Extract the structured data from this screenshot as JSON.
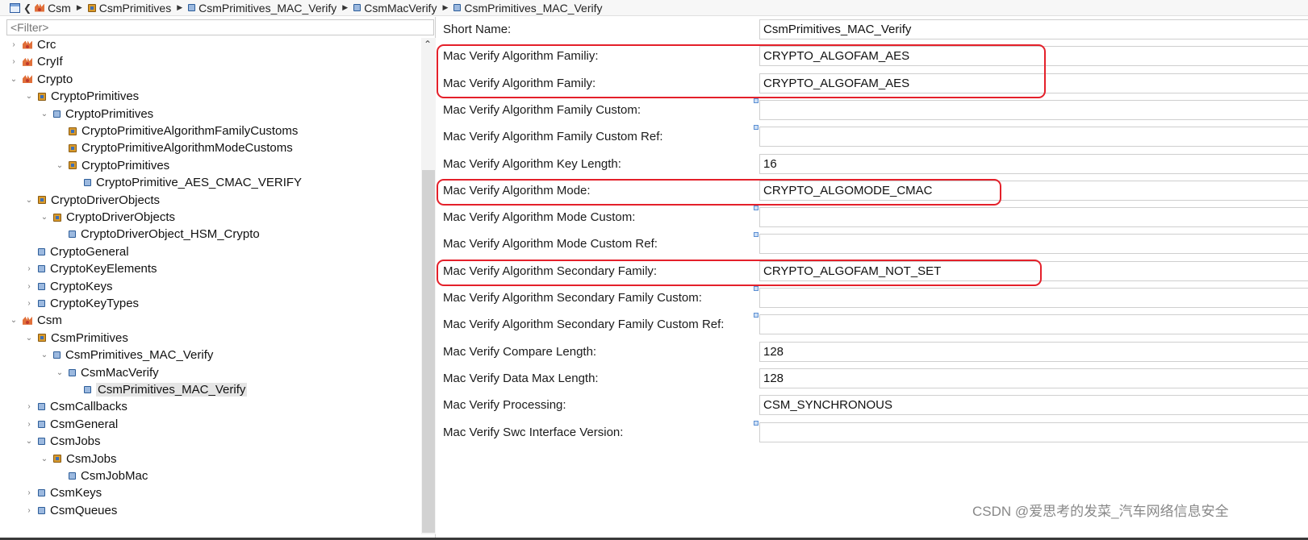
{
  "breadcrumb": [
    {
      "label": "Csm",
      "icon": "module-icon"
    },
    {
      "label": "CsmPrimitives",
      "icon": "package-icon"
    },
    {
      "label": "CsmPrimitives_MAC_Verify",
      "icon": "container-icon"
    },
    {
      "label": "CsmMacVerify",
      "icon": "container-icon"
    },
    {
      "label": "CsmPrimitives_MAC_Verify",
      "icon": "container-icon"
    }
  ],
  "tree": {
    "filter_placeholder": "<Filter>",
    "items": [
      {
        "label": "Crc",
        "level": 0,
        "twisty": "collapsed",
        "icon": "module-icon"
      },
      {
        "label": "CryIf",
        "level": 0,
        "twisty": "collapsed",
        "icon": "module-icon"
      },
      {
        "label": "Crypto",
        "level": 0,
        "twisty": "expanded",
        "icon": "module-icon"
      },
      {
        "label": "CryptoPrimitives",
        "level": 1,
        "twisty": "expanded",
        "icon": "package-icon"
      },
      {
        "label": "CryptoPrimitives",
        "level": 2,
        "twisty": "expanded",
        "icon": "container-icon"
      },
      {
        "label": "CryptoPrimitiveAlgorithmFamilyCustoms",
        "level": 3,
        "twisty": "none",
        "icon": "package-icon"
      },
      {
        "label": "CryptoPrimitiveAlgorithmModeCustoms",
        "level": 3,
        "twisty": "none",
        "icon": "package-icon"
      },
      {
        "label": "CryptoPrimitives",
        "level": 3,
        "twisty": "expanded",
        "icon": "package-icon"
      },
      {
        "label": "CryptoPrimitive_AES_CMAC_VERIFY",
        "level": 4,
        "twisty": "none",
        "icon": "container-icon"
      },
      {
        "label": "CryptoDriverObjects",
        "level": 1,
        "twisty": "expanded",
        "icon": "package-icon"
      },
      {
        "label": "CryptoDriverObjects",
        "level": 2,
        "twisty": "expanded",
        "icon": "package-icon"
      },
      {
        "label": "CryptoDriverObject_HSM_Crypto",
        "level": 3,
        "twisty": "none",
        "icon": "container-icon"
      },
      {
        "label": "CryptoGeneral",
        "level": 1,
        "twisty": "none",
        "icon": "container-icon"
      },
      {
        "label": "CryptoKeyElements",
        "level": 1,
        "twisty": "collapsed",
        "icon": "container-icon"
      },
      {
        "label": "CryptoKeys",
        "level": 1,
        "twisty": "collapsed",
        "icon": "container-icon"
      },
      {
        "label": "CryptoKeyTypes",
        "level": 1,
        "twisty": "collapsed",
        "icon": "container-icon"
      },
      {
        "label": "Csm",
        "level": 0,
        "twisty": "expanded",
        "icon": "module-icon"
      },
      {
        "label": "CsmPrimitives",
        "level": 1,
        "twisty": "expanded",
        "icon": "package-icon"
      },
      {
        "label": "CsmPrimitives_MAC_Verify",
        "level": 2,
        "twisty": "expanded",
        "icon": "container-icon"
      },
      {
        "label": "CsmMacVerify",
        "level": 3,
        "twisty": "expanded",
        "icon": "container-icon"
      },
      {
        "label": "CsmPrimitives_MAC_Verify",
        "level": 4,
        "twisty": "none",
        "icon": "container-icon",
        "selected": true
      },
      {
        "label": "CsmCallbacks",
        "level": 1,
        "twisty": "collapsed",
        "icon": "container-icon"
      },
      {
        "label": "CsmGeneral",
        "level": 1,
        "twisty": "collapsed",
        "icon": "container-icon"
      },
      {
        "label": "CsmJobs",
        "level": 1,
        "twisty": "expanded",
        "icon": "container-icon"
      },
      {
        "label": "CsmJobs",
        "level": 2,
        "twisty": "expanded",
        "icon": "package-icon"
      },
      {
        "label": "CsmJobMac",
        "level": 3,
        "twisty": "none",
        "icon": "container-icon"
      },
      {
        "label": "CsmKeys",
        "level": 1,
        "twisty": "collapsed",
        "icon": "container-icon"
      },
      {
        "label": "CsmQueues",
        "level": 1,
        "twisty": "collapsed",
        "icon": "container-icon"
      }
    ]
  },
  "properties": [
    {
      "label": "Short Name:",
      "value": "CsmPrimitives_MAC_Verify",
      "marker": false,
      "highlight": false
    },
    {
      "label": "Mac Verify Algorithm Familiy:",
      "value": "CRYPTO_ALGOFAM_AES",
      "marker": false,
      "highlight": true
    },
    {
      "label": "Mac Verify Algorithm Family:",
      "value": "CRYPTO_ALGOFAM_AES",
      "marker": false,
      "highlight": true
    },
    {
      "label": "Mac Verify Algorithm Family Custom:",
      "value": "",
      "marker": true,
      "highlight": false
    },
    {
      "label": "Mac Verify Algorithm Family Custom Ref:",
      "value": "",
      "marker": true,
      "highlight": false
    },
    {
      "label": "Mac Verify Algorithm Key Length:",
      "value": "16",
      "marker": false,
      "highlight": false
    },
    {
      "label": "Mac Verify Algorithm Mode:",
      "value": "CRYPTO_ALGOMODE_CMAC",
      "marker": false,
      "highlight": true
    },
    {
      "label": "Mac Verify Algorithm Mode Custom:",
      "value": "",
      "marker": true,
      "highlight": false
    },
    {
      "label": "Mac Verify Algorithm Mode Custom Ref:",
      "value": "",
      "marker": true,
      "highlight": false
    },
    {
      "label": "Mac Verify Algorithm Secondary Family:",
      "value": "CRYPTO_ALGOFAM_NOT_SET",
      "marker": false,
      "highlight": true
    },
    {
      "label": "Mac Verify Algorithm Secondary Family Custom:",
      "value": "",
      "marker": true,
      "highlight": false
    },
    {
      "label": "Mac Verify Algorithm Secondary Family Custom Ref:",
      "value": "",
      "marker": true,
      "highlight": false
    },
    {
      "label": "Mac Verify Compare Length:",
      "value": "128",
      "marker": false,
      "highlight": false
    },
    {
      "label": "Mac Verify Data Max Length:",
      "value": "128",
      "marker": false,
      "highlight": false
    },
    {
      "label": "Mac Verify Processing:",
      "value": "CSM_SYNCHRONOUS",
      "marker": false,
      "highlight": false
    },
    {
      "label": "Mac Verify Swc Interface Version:",
      "value": "",
      "marker": true,
      "highlight": false
    }
  ],
  "watermark": "CSDN @爱思考的发菜_汽车网络信息安全",
  "colors": {
    "highlight": "#e4202a",
    "selection": "#e5e5e5"
  }
}
